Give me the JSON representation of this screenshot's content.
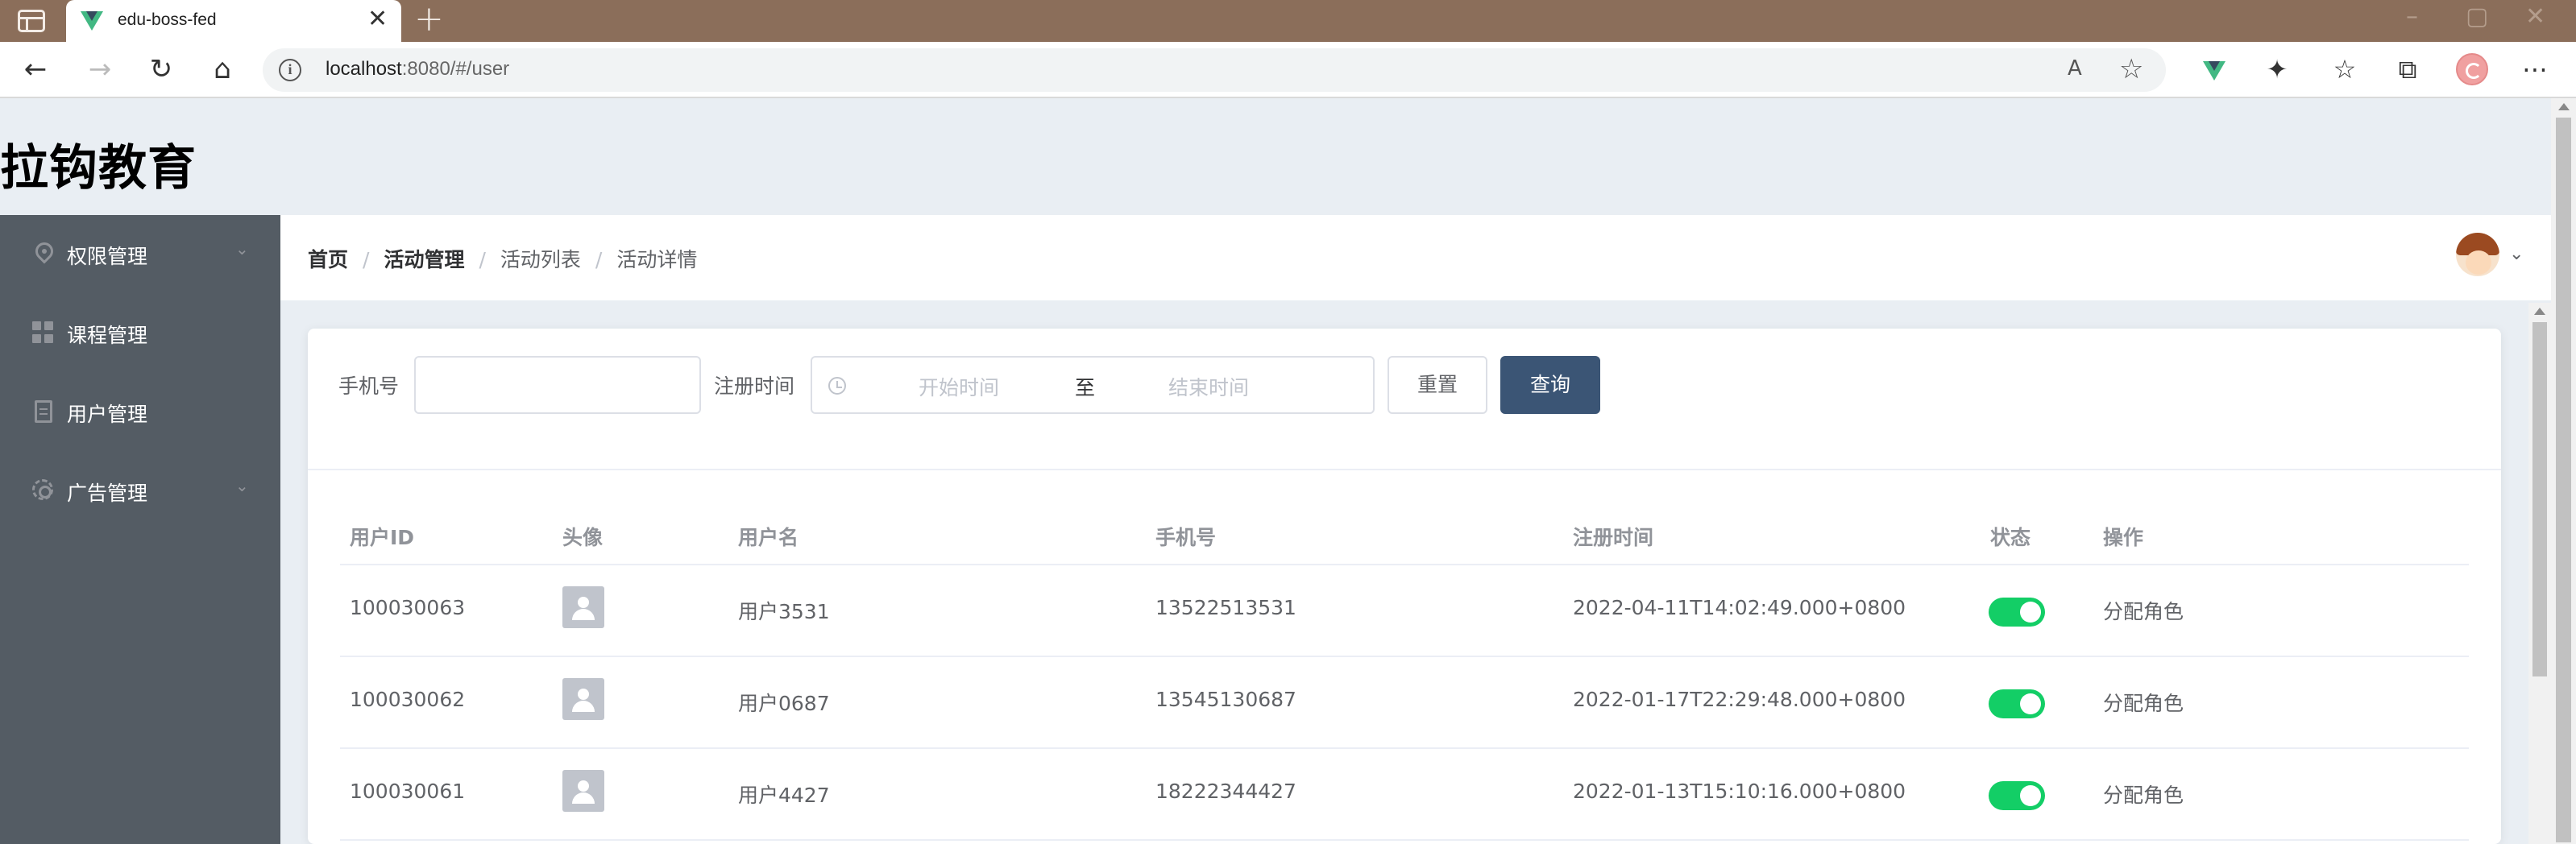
{
  "browser": {
    "tab_title": "edu-boss-fed",
    "tab_close": "✕",
    "new_tab": "+",
    "url_host": "localhost",
    "url_rest": ":8080/#/user",
    "icons": [
      "tab-actions-icon",
      "back-icon",
      "forward-icon",
      "refresh-icon",
      "home-icon",
      "info-icon",
      "read-aloud-icon",
      "favorite-add-icon",
      "vue-devtools-icon",
      "extensions-icon",
      "favorites-icon",
      "collections-icon",
      "profile-icon",
      "menu-icon"
    ]
  },
  "app": {
    "logo": "拉钩教育"
  },
  "sidebar": {
    "background": "#545c64",
    "items": [
      {
        "label": "权限管理",
        "icon": "location-icon",
        "has_submenu": true
      },
      {
        "label": "课程管理",
        "icon": "grid-icon",
        "has_submenu": false
      },
      {
        "label": "用户管理",
        "icon": "document-icon",
        "has_submenu": false
      },
      {
        "label": "广告管理",
        "icon": "gear-icon",
        "has_submenu": true
      }
    ]
  },
  "breadcrumb": [
    "首页",
    "活动管理",
    "活动列表",
    "活动详情"
  ],
  "filter": {
    "phone_label": "手机号",
    "phone_value": "",
    "date_label": "注册时间",
    "start_placeholder": "开始时间",
    "range_separator": "至",
    "end_placeholder": "结束时间",
    "reset_label": "重置",
    "query_label": "查询",
    "query_color": "#3b5575"
  },
  "table": {
    "columns": [
      "用户ID",
      "头像",
      "用户名",
      "手机号",
      "注册时间",
      "状态",
      "操作"
    ],
    "rows": [
      {
        "id": "100030063",
        "name": "用户3531",
        "phone": "13522513531",
        "created": "2022-04-11T14:02:49.000+0800",
        "status": true,
        "action": "分配角色"
      },
      {
        "id": "100030062",
        "name": "用户0687",
        "phone": "13545130687",
        "created": "2022-01-17T22:29:48.000+0800",
        "status": true,
        "action": "分配角色"
      },
      {
        "id": "100030061",
        "name": "用户4427",
        "phone": "18222344427",
        "created": "2022-01-13T15:10:16.000+0800",
        "status": true,
        "action": "分配角色"
      }
    ],
    "switch_on_color": "#13ce66"
  }
}
